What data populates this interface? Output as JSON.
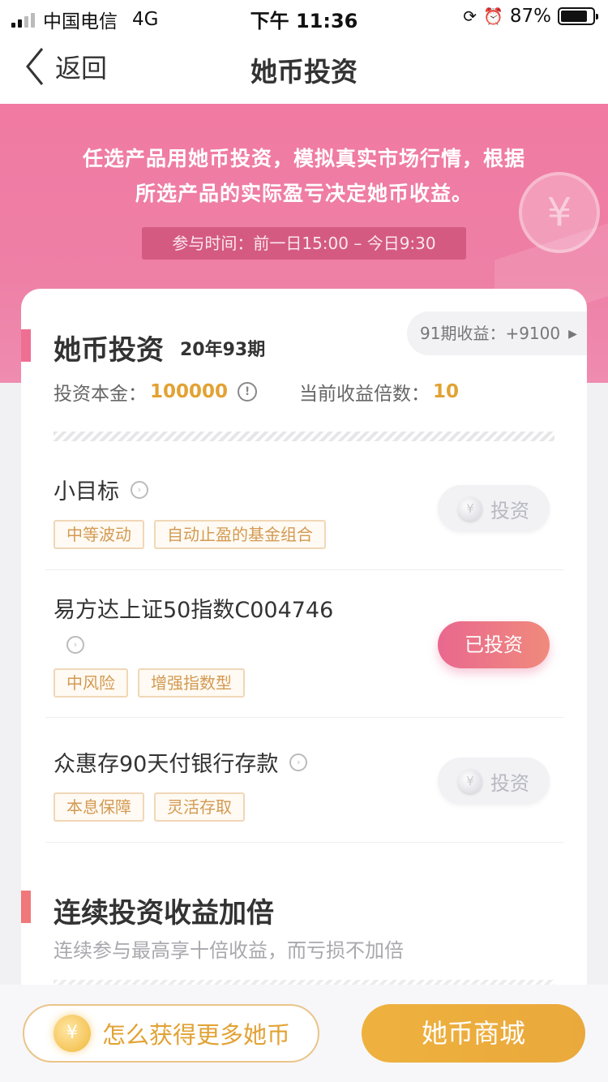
{
  "status_bar": {
    "carrier": "中国电信",
    "network": "4G",
    "time": "下午 11:36",
    "battery": "87%"
  },
  "nav": {
    "back_label": "返回",
    "title": "她币投资"
  },
  "banner": {
    "line1": "任选产品用她币投资，模拟真实市场行情，根据",
    "line2": "所选产品的实际盈亏决定她币收益。",
    "time_text": "参与时间：前一日15:00 – 今日9:30",
    "deco_symbol": "¥"
  },
  "card": {
    "title": "她币投资",
    "period": "20年93期",
    "prev_result": "91期收益：+9100",
    "principal_label": "投资本金：",
    "principal_value": "100000",
    "multiplier_label": "当前收益倍数：",
    "multiplier_value": "10",
    "info_icon": "!"
  },
  "products": [
    {
      "name": "小目标",
      "tags": [
        "中等波动",
        "自动止盈的基金组合"
      ],
      "action": "投资",
      "invested": false
    },
    {
      "name": "易方达上证50指数C004746",
      "tags": [
        "中风险",
        "增强指数型"
      ],
      "action": "已投资",
      "invested": true
    },
    {
      "name": "众惠存90天付银行存款",
      "tags": [
        "本息保障",
        "灵活存取"
      ],
      "action": "投资",
      "invested": false
    }
  ],
  "coin_symbol": "¥",
  "section": {
    "title": "连续投资收益加倍",
    "subtitle": "连续参与最高享十倍收益，而亏损不加倍"
  },
  "bottom": {
    "more_coins_label": "怎么获得更多她币",
    "shop_label": "她币商城"
  },
  "colors": {
    "banner_pink": "#f07aa2",
    "accent_pink": "#ef6f93",
    "gold": "#e2a233",
    "tag_text": "#d39a52"
  }
}
